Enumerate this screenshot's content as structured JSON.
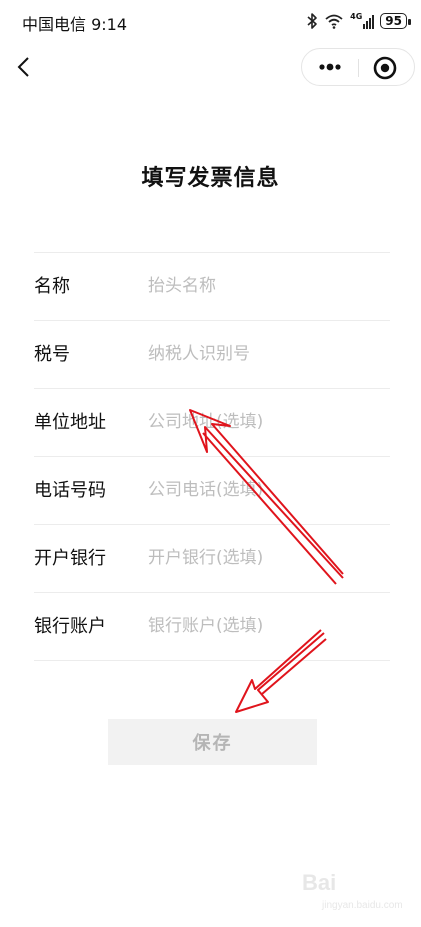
{
  "status_bar": {
    "carrier_time": "中国电信 9:14",
    "icons": [
      "bluetooth-icon",
      "wifi-icon",
      "signal-4g-icon"
    ],
    "network_label": "4G",
    "battery": "95"
  },
  "nav": {
    "back_icon": "chevron-left-icon",
    "more_icon": "more-dots-icon",
    "target_icon": "target-icon"
  },
  "page": {
    "title": "填写发票信息"
  },
  "form": {
    "rows": [
      {
        "label": "名称",
        "placeholder": "抬头名称",
        "value": ""
      },
      {
        "label": "税号",
        "placeholder": "纳税人识别号",
        "value": ""
      },
      {
        "label": "单位地址",
        "placeholder": "公司地址(选填)",
        "value": ""
      },
      {
        "label": "电话号码",
        "placeholder": "公司电话(选填)",
        "value": ""
      },
      {
        "label": "开户银行",
        "placeholder": "开户银行(选填)",
        "value": ""
      },
      {
        "label": "银行账户",
        "placeholder": "银行账户(选填)",
        "value": ""
      }
    ]
  },
  "actions": {
    "save_label": "保存"
  },
  "colors": {
    "annotation_arrow": "#e0141c",
    "save_bg": "#f2f2f2",
    "placeholder": "#bdbdbd"
  },
  "watermark": {
    "text": "Bai",
    "sub": "jingyan.baidu.com"
  }
}
